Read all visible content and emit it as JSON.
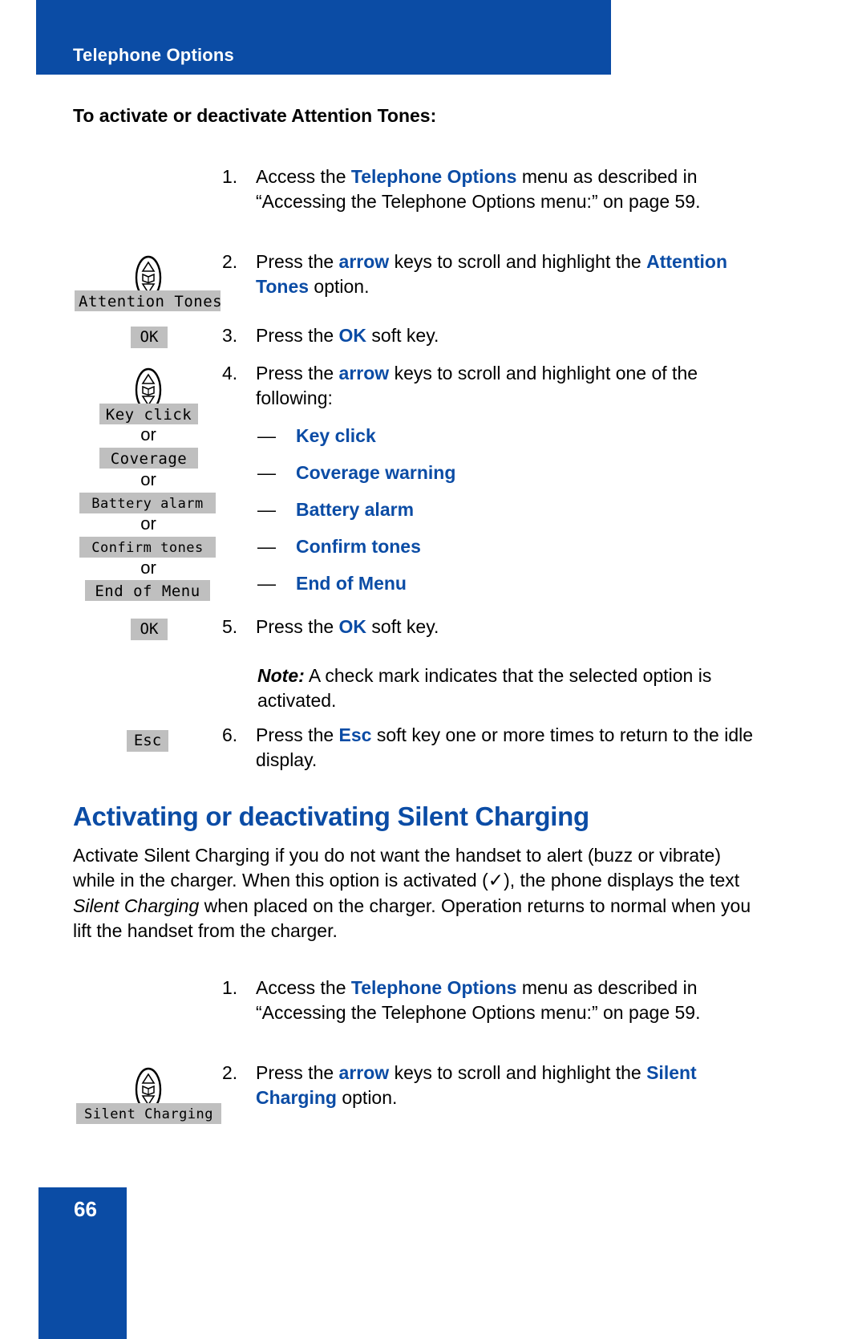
{
  "header": {
    "title": "Telephone Options",
    "bar_color": "#0B4CA5"
  },
  "section_intro": "To activate or deactivate Attention Tones:",
  "attention_tones_steps": [
    {
      "number": "1.",
      "text_parts": [
        {
          "t": "Access the ",
          "style": "plain"
        },
        {
          "t": "Telephone Options",
          "style": "blue-bold"
        },
        {
          "t": " menu as described in “Accessing the Telephone Options menu:” on page 59.",
          "style": "plain"
        }
      ]
    },
    {
      "number": "2.",
      "text_parts": [
        {
          "t": "Press the ",
          "style": "plain"
        },
        {
          "t": "arrow",
          "style": "blue-bold"
        },
        {
          "t": " keys to scroll and highlight the ",
          "style": "plain"
        },
        {
          "t": "Attention Tones",
          "style": "blue-bold"
        },
        {
          "t": " option.",
          "style": "plain"
        }
      ]
    },
    {
      "number": "3.",
      "text_parts": [
        {
          "t": "Press the ",
          "style": "plain"
        },
        {
          "t": "OK",
          "style": "blue-bold"
        },
        {
          "t": " soft key.",
          "style": "plain"
        }
      ]
    },
    {
      "number": "4.",
      "text_parts": [
        {
          "t": "Press the ",
          "style": "plain"
        },
        {
          "t": "arrow",
          "style": "blue-bold"
        },
        {
          "t": " keys to scroll and highlight one of the following:",
          "style": "plain"
        }
      ]
    },
    {
      "number": "5.",
      "text_parts": [
        {
          "t": "Press the ",
          "style": "plain"
        },
        {
          "t": "OK",
          "style": "blue-bold"
        },
        {
          "t": " soft key.",
          "style": "plain"
        }
      ]
    },
    {
      "number": "6.",
      "text_parts": [
        {
          "t": "Press the ",
          "style": "plain"
        },
        {
          "t": "Esc",
          "style": "blue-bold"
        },
        {
          "t": " soft key one or more times to return to the idle display.",
          "style": "plain"
        }
      ]
    }
  ],
  "option_list": [
    {
      "dash": "—",
      "label": "Key click"
    },
    {
      "dash": "—",
      "label": "Coverage warning"
    },
    {
      "dash": "—",
      "label": "Battery alarm"
    },
    {
      "dash": "—",
      "label": "Confirm tones"
    },
    {
      "dash": "—",
      "label": "End of Menu"
    }
  ],
  "note": {
    "label": "Note:",
    "text": " A check mark indicates that the selected option is activated."
  },
  "lcd_displays": {
    "attention_tones": "Attention Tones",
    "key_click": "Key click",
    "coverage": "Coverage",
    "battery_alarm": "Battery alarm",
    "confirm_tones": "Confirm tones",
    "end_of_menu": "End of Menu",
    "silent_charging": "Silent Charging"
  },
  "soft_keys": {
    "ok_step3": "OK",
    "ok_step5": "OK",
    "esc_step6": "Esc"
  },
  "or_connectors": {
    "or_1": "or",
    "or_2": "or",
    "or_3": "or",
    "or_4": "or"
  },
  "silent_charging_section": {
    "heading": "Activating or deactivating Silent Charging",
    "paragraph_parts": [
      {
        "t": "Activate Silent Charging if you do not want the handset to alert (buzz or vibrate) while in the charger. When this option is activated (",
        "style": "plain"
      },
      {
        "t": "✓",
        "style": "check"
      },
      {
        "t": "), the phone displays the text ",
        "style": "plain"
      },
      {
        "t": "Silent Charging",
        "style": "italic"
      },
      {
        "t": " when placed on the charger. Operation returns to normal when you lift the handset from the charger.",
        "style": "plain"
      }
    ],
    "steps": [
      {
        "number": "1.",
        "text_parts": [
          {
            "t": "Access the ",
            "style": "plain"
          },
          {
            "t": "Telephone Options",
            "style": "blue-bold"
          },
          {
            "t": " menu as described in “Accessing the Telephone Options menu:” on page 59.",
            "style": "plain"
          }
        ]
      },
      {
        "number": "2.",
        "text_parts": [
          {
            "t": "Press the ",
            "style": "plain"
          },
          {
            "t": "arrow",
            "style": "blue-bold"
          },
          {
            "t": " keys to scroll and highlight the ",
            "style": "plain"
          },
          {
            "t": "Silent Charging",
            "style": "blue-bold"
          },
          {
            "t": " option.",
            "style": "plain"
          }
        ]
      }
    ]
  },
  "footer": {
    "page_number": "66",
    "block_color": "#0B4CA5"
  },
  "icons": {
    "nav_key_1": "navigation-key-icon",
    "nav_key_2": "navigation-key-icon",
    "nav_key_3": "navigation-key-icon"
  },
  "colors": {
    "accent_blue": "#0B4CA5",
    "lcd_gray": "#BFBFBF",
    "text_black": "#000000"
  }
}
